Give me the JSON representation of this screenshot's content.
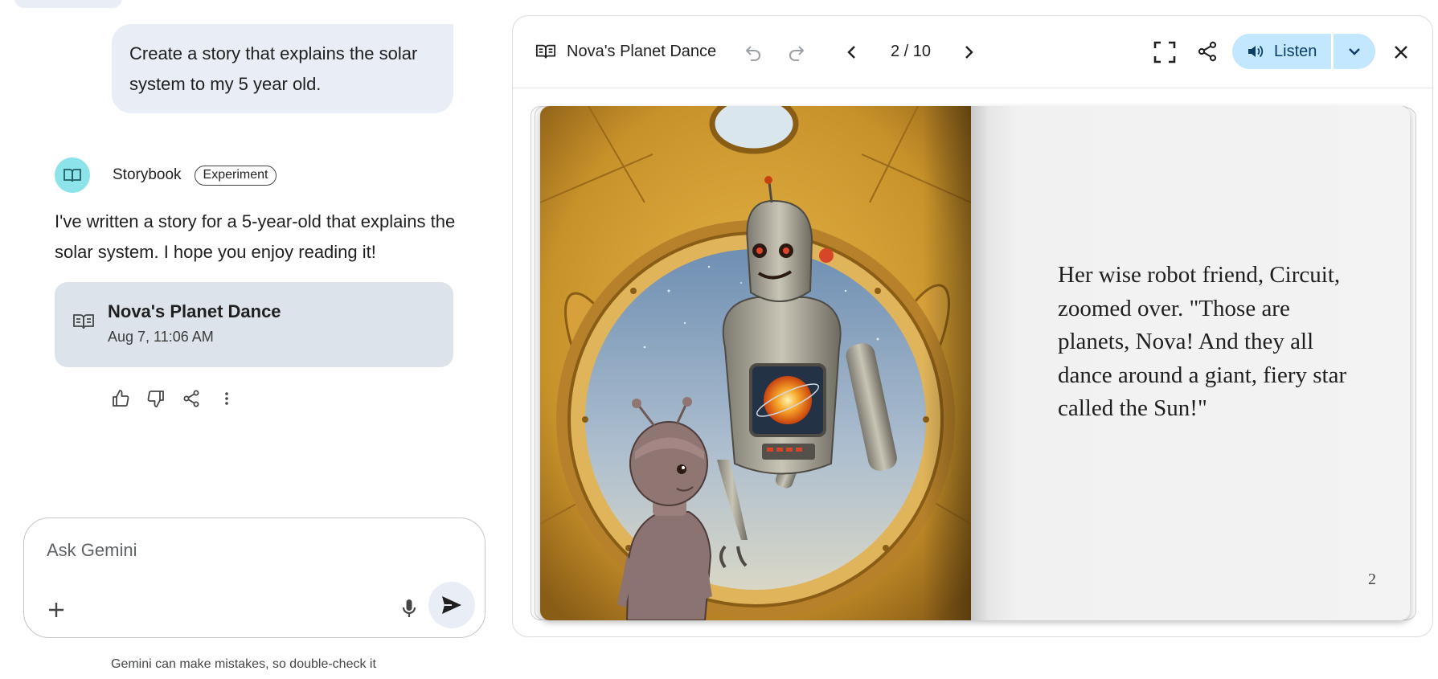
{
  "chat": {
    "user_prompt": "Create a story that explains the solar system to my 5 year old.",
    "agent_name": "Storybook",
    "agent_badge": "Experiment",
    "agent_message": "I've written a story for a 5-year-old that explains the solar system. I hope you enjoy reading it!",
    "story_card": {
      "title": "Nova's Planet Dance",
      "date": "Aug 7, 11:06 AM"
    },
    "feedback_icons": [
      "thumbs-up-icon",
      "thumbs-down-icon",
      "share-icon",
      "more-vert-icon"
    ]
  },
  "composer": {
    "placeholder": "Ask Gemini",
    "disclaimer": "Gemini can make mistakes, so double-check it"
  },
  "viewer": {
    "title": "Nova's Planet Dance",
    "page_indicator": "2 / 10",
    "listen_label": "Listen",
    "page_text": "Her wise robot friend, Circuit, zoomed over. \"Those are planets, Nova! And they all dance around a giant, fiery star called the Sun!\"",
    "page_number": "2",
    "colors": {
      "listen_bg": "#c2e7ff",
      "bubble_bg": "#e9eef6",
      "card_bg": "#dde3ea",
      "avatar_bg": "#8ce3e9"
    }
  }
}
